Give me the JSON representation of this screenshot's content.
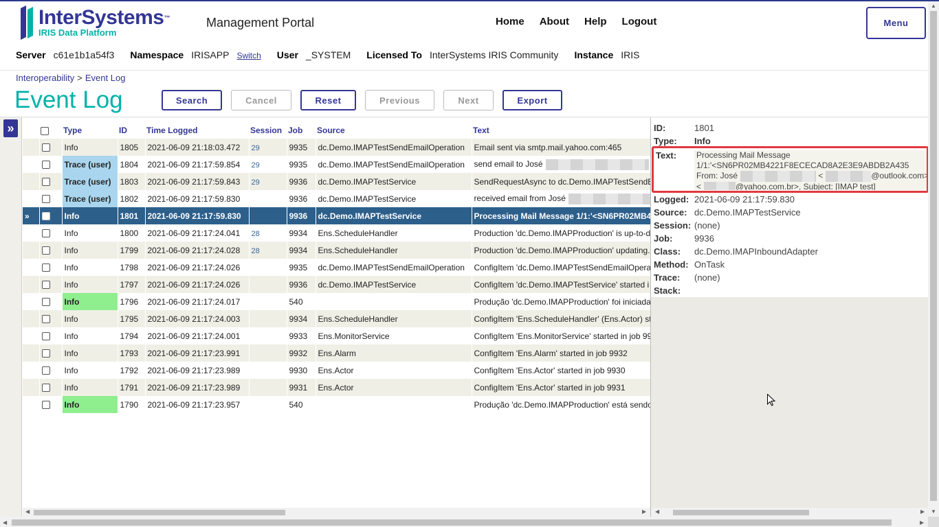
{
  "brand": {
    "name": "InterSystems",
    "tm": "™",
    "sub": "IRIS Data Platform"
  },
  "portal_title": "Management Portal",
  "nav": {
    "home": "Home",
    "about": "About",
    "help": "Help",
    "logout": "Logout",
    "menu": "Menu"
  },
  "info": {
    "server_label": "Server",
    "server": "c61e1b1a54f3",
    "namespace_label": "Namespace",
    "namespace": "IRISAPP",
    "switch": "Switch",
    "user_label": "User",
    "user": "_SYSTEM",
    "licensed_label": "Licensed To",
    "licensed": "InterSystems IRIS Community",
    "instance_label": "Instance",
    "instance": "IRIS"
  },
  "breadcrumb": {
    "root": "Interoperability",
    "sep": ">",
    "current": "Event Log"
  },
  "page_title": "Event Log",
  "toolbar": {
    "search": "Search",
    "cancel": "Cancel",
    "reset": "Reset",
    "previous": "Previous",
    "next": "Next",
    "export": "Export"
  },
  "grid": {
    "headers": {
      "type": "Type",
      "id": "ID",
      "time": "Time Logged",
      "session": "Session",
      "job": "Job",
      "source": "Source",
      "text": "Text"
    },
    "selected_marker": "»",
    "rows": [
      {
        "type": "Info",
        "id": "1805",
        "time": "2021-06-09 21:18:03.472",
        "session": "29",
        "job": "9935",
        "source": "dc.Demo.IMAPTestSendEmailOperation",
        "text": "Email sent via smtp.mail.yahoo.com:465"
      },
      {
        "type": "Trace (user)",
        "id": "1804",
        "time": "2021-06-09 21:17:59.854",
        "session": "29",
        "job": "9935",
        "source": "dc.Demo.IMAPTestSendEmailOperation",
        "text": "send email to José"
      },
      {
        "type": "Trace (user)",
        "id": "1803",
        "time": "2021-06-09 21:17:59.843",
        "session": "29",
        "job": "9936",
        "source": "dc.Demo.IMAPTestService",
        "text": "SendRequestAsync to dc.Demo.IMAPTestSendE"
      },
      {
        "type": "Trace (user)",
        "id": "1802",
        "time": "2021-06-09 21:17:59.830",
        "session": "",
        "job": "9936",
        "source": "dc.Demo.IMAPTestService",
        "text": "received email from José"
      },
      {
        "type": "Info",
        "id": "1801",
        "time": "2021-06-09 21:17:59.830",
        "session": "",
        "job": "9936",
        "source": "dc.Demo.IMAPTestService",
        "text": "Processing Mail Message 1/1:'<SN6PR02MB4"
      },
      {
        "type": "Info",
        "id": "1800",
        "time": "2021-06-09 21:17:24.041",
        "session": "28",
        "job": "9934",
        "source": "Ens.ScheduleHandler",
        "text": "Production 'dc.Demo.IMAPProduction' is up-to-d"
      },
      {
        "type": "Info",
        "id": "1799",
        "time": "2021-06-09 21:17:24.028",
        "session": "28",
        "job": "9934",
        "source": "Ens.ScheduleHandler",
        "text": "Production 'dc.Demo.IMAPProduction' updating."
      },
      {
        "type": "Info",
        "id": "1798",
        "time": "2021-06-09 21:17:24.026",
        "session": "",
        "job": "9935",
        "source": "dc.Demo.IMAPTestSendEmailOperation",
        "text": "ConfigItem 'dc.Demo.IMAPTestSendEmailOpera"
      },
      {
        "type": "Info",
        "id": "1797",
        "time": "2021-06-09 21:17:24.026",
        "session": "",
        "job": "9936",
        "source": "dc.Demo.IMAPTestService",
        "text": "ConfigItem 'dc.Demo.IMAPTestService' started i"
      },
      {
        "type": "Info",
        "id": "1796",
        "time": "2021-06-09 21:17:24.017",
        "session": "",
        "job": "540",
        "source": "",
        "text": "Produção 'dc.Demo.IMAPProduction' foi iniciada"
      },
      {
        "type": "Info",
        "id": "1795",
        "time": "2021-06-09 21:17:24.003",
        "session": "",
        "job": "9934",
        "source": "Ens.ScheduleHandler",
        "text": "ConfigItem 'Ens.ScheduleHandler' (Ens.Actor) st"
      },
      {
        "type": "Info",
        "id": "1794",
        "time": "2021-06-09 21:17:24.001",
        "session": "",
        "job": "9933",
        "source": "Ens.MonitorService",
        "text": "ConfigItem 'Ens.MonitorService' started in job 99"
      },
      {
        "type": "Info",
        "id": "1793",
        "time": "2021-06-09 21:17:23.991",
        "session": "",
        "job": "9932",
        "source": "Ens.Alarm",
        "text": "ConfigItem 'Ens.Alarm' started in job 9932"
      },
      {
        "type": "Info",
        "id": "1792",
        "time": "2021-06-09 21:17:23.989",
        "session": "",
        "job": "9930",
        "source": "Ens.Actor",
        "text": "ConfigItem 'Ens.Actor' started in job 9930"
      },
      {
        "type": "Info",
        "id": "1791",
        "time": "2021-06-09 21:17:23.989",
        "session": "",
        "job": "9931",
        "source": "Ens.Actor",
        "text": "ConfigItem 'Ens.Actor' started in job 9931"
      },
      {
        "type": "Info",
        "id": "1790",
        "time": "2021-06-09 21:17:23.957",
        "session": "",
        "job": "540",
        "source": "",
        "text": "Produção 'dc.Demo.IMAPProduction' está sendo"
      }
    ]
  },
  "detail": {
    "id_label": "ID:",
    "id": "1801",
    "type_label": "Type:",
    "type": "Info",
    "text_label": "Text:",
    "text_line1": "Processing Mail Message",
    "text_line2": "1/1:'<SN6PR02MB4221F8ECECAD8A2E3E9ABDB2A435",
    "text_line3_prefix": "From: José",
    "text_line3_suffix": "@outlook.com>",
    "text_line4_prefix": "<",
    "text_line4_suffix": "@yahoo.com.br>, Subject: [IMAP test]",
    "logged_label": "Logged:",
    "logged": "2021-06-09 21:17:59.830",
    "source_label": "Source:",
    "source": "dc.Demo.IMAPTestService",
    "session_label": "Session:",
    "session": "(none)",
    "job_label": "Job:",
    "job": "9936",
    "class_label": "Class:",
    "class": "dc.Demo.IMAPInboundAdapter",
    "method_label": "Method:",
    "method": "OnTask",
    "trace_label": "Trace:",
    "trace": "(none)",
    "stack_label": "Stack:"
  },
  "colors": {
    "brand_navy": "#333695",
    "brand_teal": "#00b2a9",
    "selected_row": "#2d5f8b",
    "trace_badge": "#a9d6ee",
    "info_green": "#8fef8f",
    "highlight_red": "#e0393e"
  },
  "icons": {
    "side_toggle": "double-chevron-right-icon"
  }
}
